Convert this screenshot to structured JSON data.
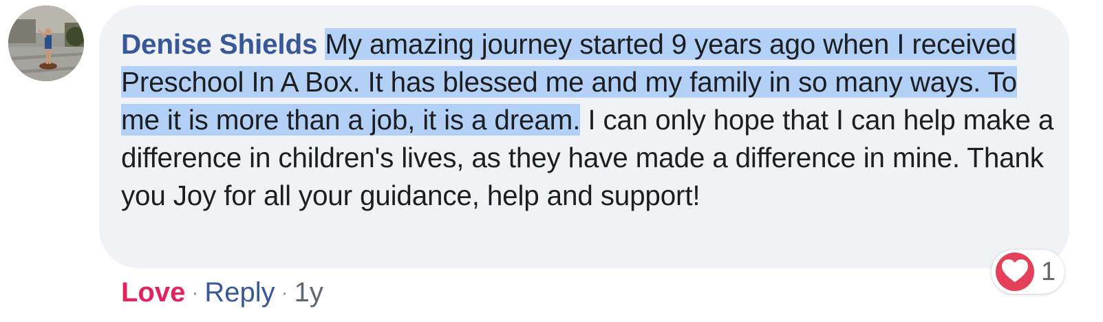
{
  "comment": {
    "author": "Denise Shields",
    "text_highlighted": "My amazing journey started 9 years ago when I received Preschool In A Box. It has blessed me and my family in so many ways. To me it is more than a job, it is a dream.",
    "text_rest": " I can only hope that I can help make a difference in children's lives, as they have made a difference in mine. Thank you Joy for all your guidance, help and support!",
    "avatar_alt": "profile-photo"
  },
  "actions": {
    "love_label": "Love",
    "separator": "·",
    "reply_label": "Reply",
    "timestamp": "1y"
  },
  "reactions": {
    "icon": "heart-icon",
    "count": "1"
  },
  "colors": {
    "author": "#385898",
    "love": "#e0245e",
    "bubble_bg": "#f0f2f5",
    "highlight": "#b3d1f6",
    "heart_bg": "#e4405a"
  }
}
